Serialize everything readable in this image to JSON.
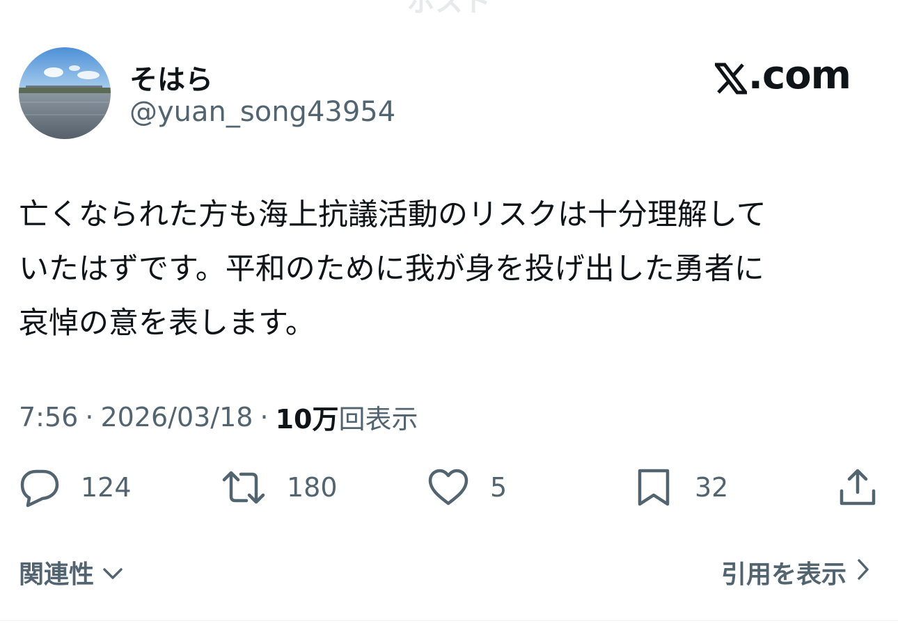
{
  "header": {
    "title": "ポスト"
  },
  "author": {
    "display_name": "そはら",
    "handle": "@yuan_song43954"
  },
  "brand": {
    "text": ".com",
    "logo_icon": "x-logo-icon"
  },
  "tweet": {
    "lines": [
      "亡くなられた方も海上抗議活動のリスクは十分理解して",
      "いたはずです。平和のために我が身を投げ出した勇者に",
      "哀悼の意を表します。"
    ]
  },
  "meta": {
    "time": "7:56",
    "separator": "·",
    "date": "2026/03/18",
    "views_count": "10万",
    "views_label": "回表示"
  },
  "actions": {
    "reply": {
      "icon": "reply-icon",
      "count": "124"
    },
    "repost": {
      "icon": "repost-icon",
      "count": "180"
    },
    "like": {
      "icon": "heart-icon",
      "count": "5"
    },
    "bookmark": {
      "icon": "bookmark-icon",
      "count": "32"
    },
    "share": {
      "icon": "share-icon"
    }
  },
  "footer": {
    "sort_label": "関連性",
    "view_quotes_label": "引用を表示"
  },
  "colors": {
    "text_primary": "#0f1419",
    "text_secondary": "#536471",
    "background": "#ffffff"
  }
}
